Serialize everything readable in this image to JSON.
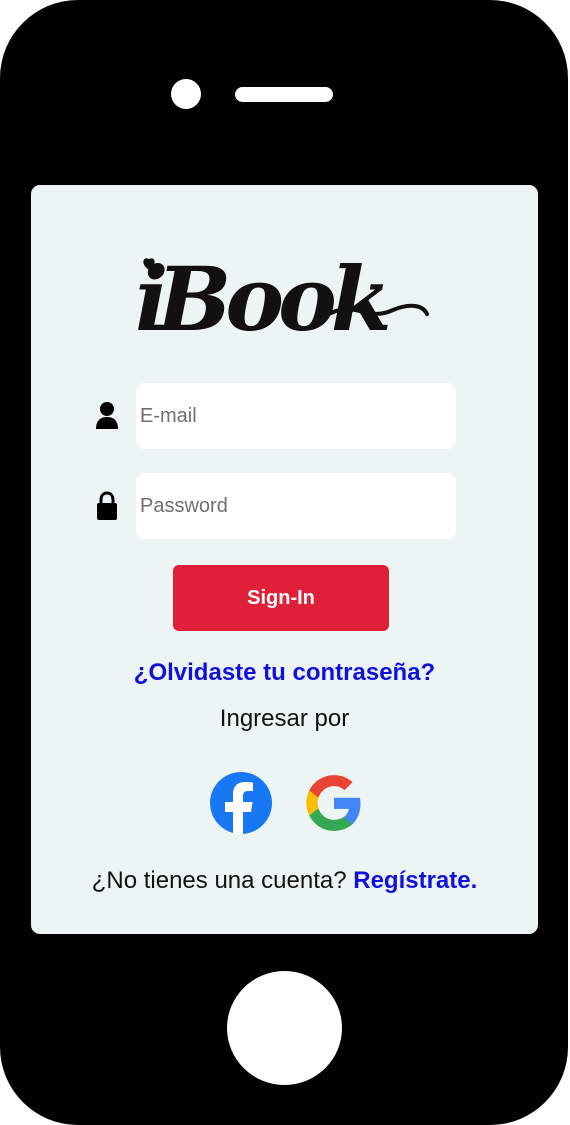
{
  "app": {
    "logo_text": "iBook"
  },
  "login_form": {
    "email_placeholder": "E-mail",
    "email_value": "",
    "password_placeholder": "Password",
    "password_value": "",
    "signin_label": "Sign-In",
    "forgot_password_link": "¿Olvidaste tu contraseña?"
  },
  "social_login": {
    "label": "Ingresar por",
    "providers": [
      "facebook-icon",
      "google-icon"
    ]
  },
  "signup": {
    "prompt": "¿No tienes una cuenta?",
    "link": "Regístrate."
  },
  "colors": {
    "phone_frame": "#000000",
    "screen_background": "#edf5f4",
    "primary_button": "#e01f38",
    "link": "#1111dd",
    "facebook": "#1877f2"
  }
}
